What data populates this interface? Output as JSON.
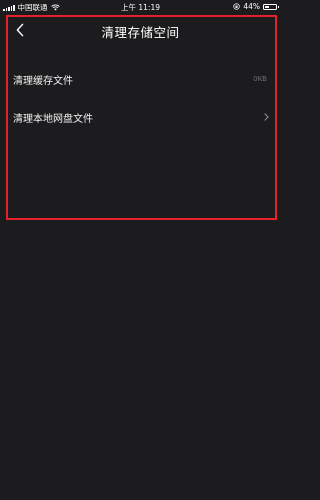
{
  "status_bar": {
    "carrier": "中国联通",
    "time": "上午 11:19",
    "battery": "44%",
    "battery_level": 0.44,
    "icons": [
      "signal-icon",
      "wifi-icon",
      "rotation-lock-icon",
      "battery-icon"
    ]
  },
  "nav": {
    "title": "清理存储空间",
    "back_icon": "chevron-left-icon"
  },
  "items": [
    {
      "label": "清理缓存文件",
      "value": "0KB"
    },
    {
      "label": "清理本地网盘文件",
      "value": "",
      "icon": "chevron-right-icon"
    }
  ],
  "colors": {
    "background": "#1c1c1e",
    "text": "#f2f2f2",
    "muted": "#6f6f73",
    "highlight": "#e8202a"
  }
}
